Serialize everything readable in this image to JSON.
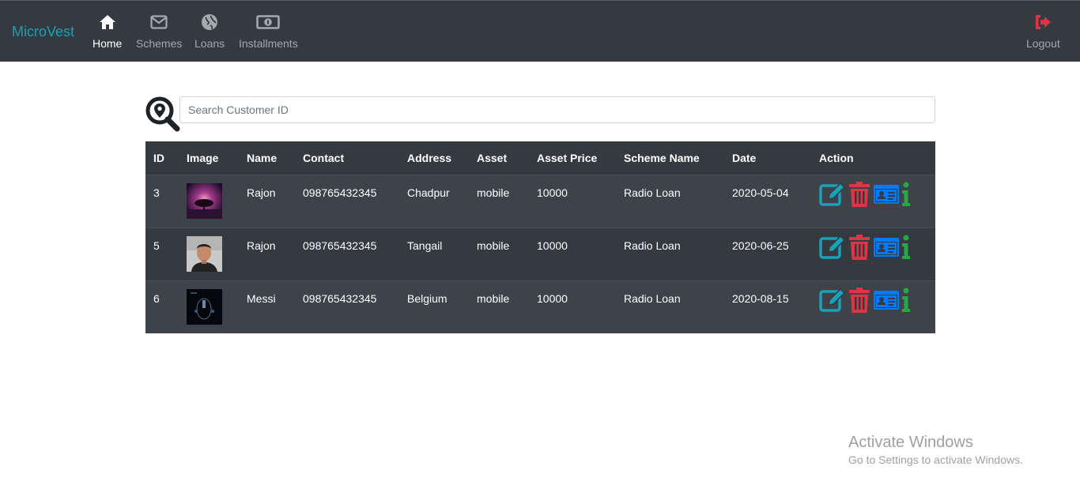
{
  "navbar": {
    "brand": "MicroVest",
    "items": [
      {
        "label": "Home",
        "icon": "home-icon",
        "active": true
      },
      {
        "label": "Schemes",
        "icon": "envelope-icon"
      },
      {
        "label": "Loans",
        "icon": "globe-icon"
      },
      {
        "label": "Installments",
        "icon": "money-bill-icon"
      }
    ],
    "logout": {
      "label": "Logout",
      "icon": "sign-out-icon"
    }
  },
  "search": {
    "placeholder": "Search Customer ID",
    "value": "",
    "icon": "search-location-icon"
  },
  "table": {
    "headers": [
      "ID",
      "Image",
      "Name",
      "Contact",
      "Address",
      "Asset",
      "Asset Price",
      "Scheme Name",
      "Date",
      "Action"
    ],
    "rows": [
      {
        "id": "3",
        "name": "Rajon",
        "contact": "098765432345",
        "address": "Chadpur",
        "asset": "mobile",
        "price": "10000",
        "scheme": "Radio Loan",
        "date": "2020-05-04",
        "image": "purple-tree-image"
      },
      {
        "id": "5",
        "name": "Rajon",
        "contact": "098765432345",
        "address": "Tangail",
        "asset": "mobile",
        "price": "10000",
        "scheme": "Radio Loan",
        "date": "2020-06-25",
        "image": "portrait-image"
      },
      {
        "id": "6",
        "name": "Messi",
        "contact": "098765432345",
        "address": "Belgium",
        "asset": "mobile",
        "price": "10000",
        "scheme": "Radio Loan",
        "date": "2020-08-15",
        "image": "dark-image"
      }
    ],
    "action_icons": [
      "edit-icon",
      "trash-icon",
      "id-card-icon",
      "info-icon"
    ]
  },
  "colors": {
    "navbar_bg": "#343a40",
    "brand": "#17a2b8",
    "logout_icon": "#dc3545",
    "edit": "#17a2b8",
    "delete": "#dc3545",
    "view": "#007bff",
    "info": "#28a745"
  },
  "watermark": {
    "title": "Activate Windows",
    "subtitle": "Go to Settings to activate Windows."
  }
}
